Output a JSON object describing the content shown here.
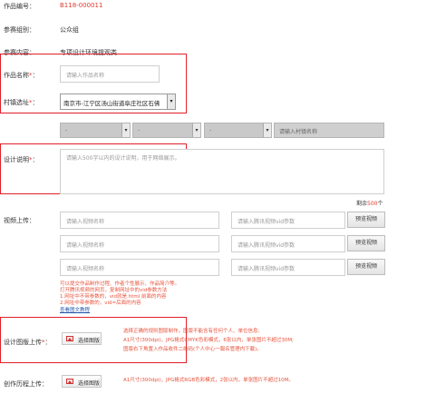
{
  "work_number": {
    "label": "作品编号：",
    "value": "B118-000011"
  },
  "group": {
    "label": "参赛组别：",
    "value": "公众组"
  },
  "content": {
    "label": "参赛内容：",
    "value": "专项设计环境提观类"
  },
  "work_name": {
    "label": "作品名称",
    "required": "*",
    "colon": "：",
    "placeholder": "请输入作品名称"
  },
  "village": {
    "label": "村镇选址",
    "required": "*",
    "colon": "：",
    "selected": "南京市-江宁区汤山街道阜庄社区石佛",
    "sub_selects": [
      "-",
      "-",
      "-"
    ],
    "name_placeholder": "请输入村镇名称"
  },
  "description": {
    "label": "设计说明",
    "required": "*",
    "colon": "：",
    "placeholder": "请输入500字以内的设计说明，用于网络展示。",
    "counter_prefix": "剩余",
    "counter_value": "500",
    "counter_suffix": "个"
  },
  "video": {
    "label": "视频上传：",
    "rows": [
      {
        "name_placeholder": "请输入视频名称",
        "vid_placeholder": "请输入腾讯视频vid参数",
        "preview": "预览视频"
      },
      {
        "name_placeholder": "请输入视频名称",
        "vid_placeholder": "请输入腾讯视频vid参数",
        "preview": "预览视频"
      },
      {
        "name_placeholder": "请输入视频名称",
        "vid_placeholder": "请输入腾讯视频vid参数",
        "preview": "预览视频"
      }
    ],
    "hints": [
      "可以提交作品制作过程、作者个性展示、作品简介等。",
      "打开腾讯视频的网页，复制网址中的vid参数方法",
      "1.网址中不带参数的，vid就是.html 前面的内容",
      "2.网址中带参数的，vid=后面的内容"
    ],
    "tutorial_link": "查看图文教程"
  },
  "design_board": {
    "label": "设计图版上传",
    "required": "*",
    "colon": "：",
    "button": "选择图版",
    "hints": [
      "选择正确的规则图版制作，图版不能含有任何个人、单位信息;",
      "A1尺寸(300dpi)，JPG格式CMYK色彩模式，6张以内，单张图片不超过30M;",
      "图版右下角置入作品收件二维码(个人中心一報名管理内下載)。"
    ]
  },
  "process": {
    "label": "创作历程上传：",
    "button": "选择图版",
    "hint": "A1尺寸(300dpi)，JPG格式RGB色彩模式，2张以内，单张图片不超过10M。"
  },
  "colors": {
    "accent_red": "#e03a2e",
    "highlight_border": "#e0202a",
    "link_blue": "#2255aa"
  }
}
